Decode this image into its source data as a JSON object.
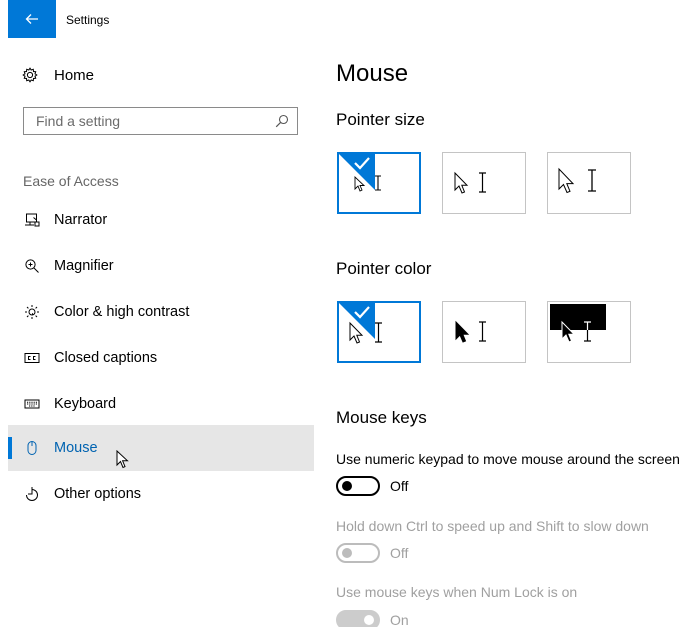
{
  "window": {
    "title": "Settings"
  },
  "sidebar": {
    "home_label": "Home",
    "search_placeholder": "Find a setting",
    "section_label": "Ease of Access",
    "items": [
      {
        "label": "Narrator",
        "icon": "narrator-icon"
      },
      {
        "label": "Magnifier",
        "icon": "magnifier-icon"
      },
      {
        "label": "Color & high contrast",
        "icon": "brightness-icon"
      },
      {
        "label": "Closed captions",
        "icon": "closed-captions-icon"
      },
      {
        "label": "Keyboard",
        "icon": "keyboard-icon"
      },
      {
        "label": "Mouse",
        "icon": "mouse-icon",
        "selected": true
      },
      {
        "label": "Other options",
        "icon": "other-options-icon"
      }
    ]
  },
  "main": {
    "title": "Mouse",
    "pointer_size": {
      "heading": "Pointer size",
      "options": [
        "small",
        "medium",
        "large"
      ],
      "selected": "small"
    },
    "pointer_color": {
      "heading": "Pointer color",
      "options": [
        "white",
        "black",
        "inverted"
      ],
      "selected": "white"
    },
    "mouse_keys": {
      "heading": "Mouse keys",
      "toggles": [
        {
          "label": "Use numeric keypad to move mouse around the screen",
          "state": "Off",
          "disabled": false
        },
        {
          "label": "Hold down Ctrl to speed up and Shift to slow down",
          "state": "Off",
          "disabled": true
        },
        {
          "label": "Use mouse keys when Num Lock is on",
          "state": "On",
          "disabled": true
        }
      ]
    }
  },
  "colors": {
    "accent": "#0078d7",
    "selected_bg": "#e6e6e6",
    "disabled_text": "#a0a0a0"
  }
}
